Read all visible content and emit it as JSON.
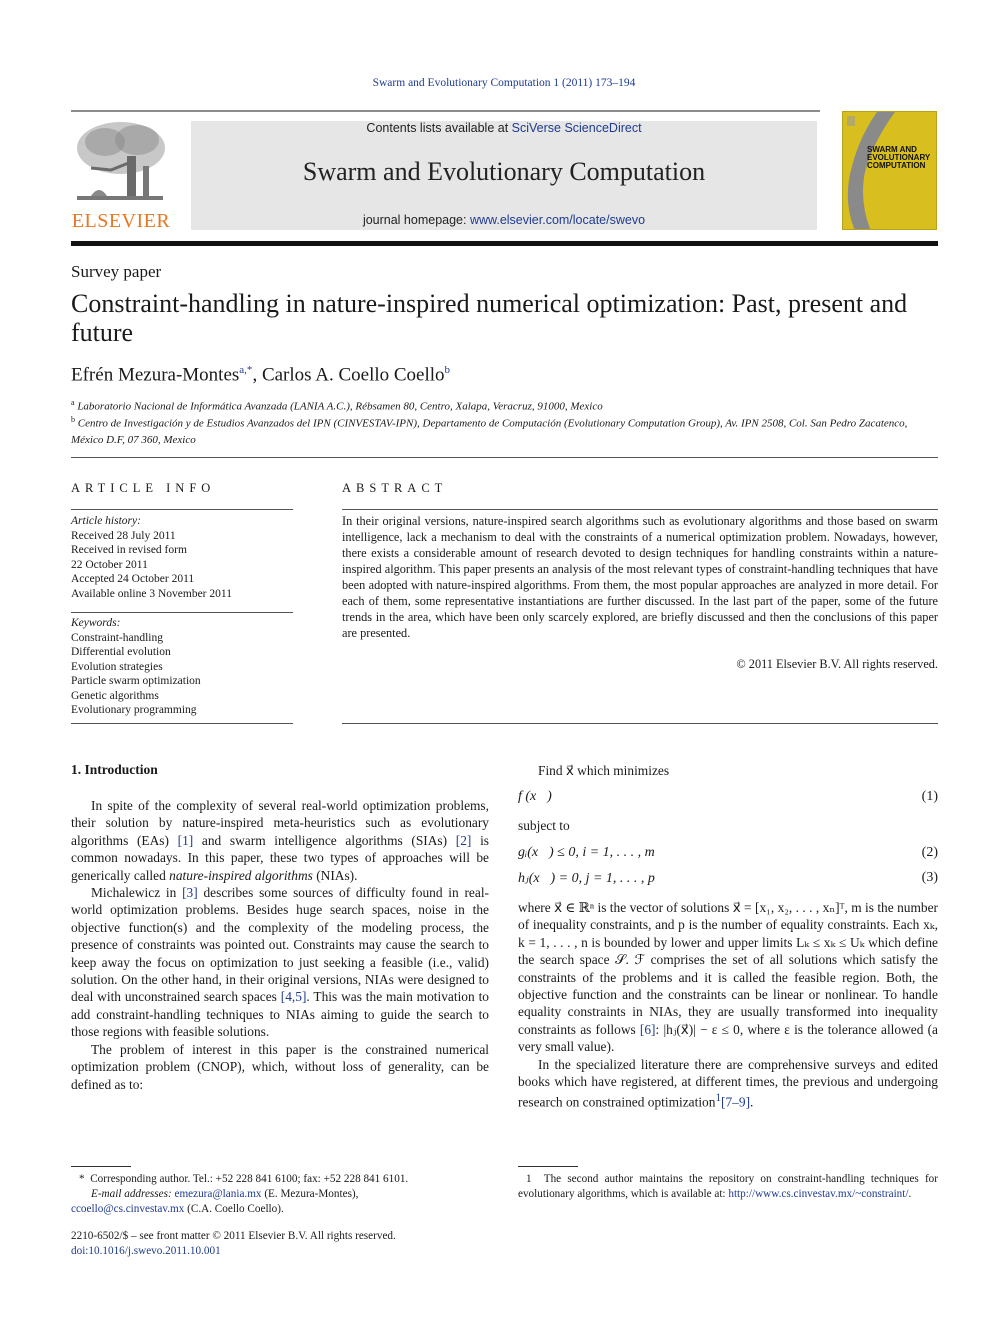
{
  "running_head": "Swarm and Evolutionary Computation 1 (2011) 173–194",
  "masthead": {
    "publisher_logo_text": "ELSEVIER",
    "contents_prefix": "Contents lists available at ",
    "contents_link": "SciVerse ScienceDirect",
    "journal_title": "Swarm and Evolutionary Computation",
    "homepage_prefix": "journal homepage: ",
    "homepage_link": "www.elsevier.com/locate/swevo",
    "cover_title_lines": [
      "SWARM AND",
      "EVOLUTIONARY",
      "COMPUTATION"
    ],
    "colors": {
      "link": "#1f3a8f",
      "elsevier_orange": "#e87722",
      "cover_yellow": "#d8bf1f",
      "cover_gray": "#8a8a8a",
      "box_gray": "#e6e6e6"
    }
  },
  "article": {
    "type": "Survey paper",
    "title": "Constraint-handling in nature-inspired numerical optimization: Past, present and future",
    "authors": [
      {
        "name": "Efrén Mezura-Montes",
        "marks": "a,*"
      },
      {
        "name": "Carlos A. Coello Coello",
        "marks": "b"
      }
    ],
    "author_separator": ", ",
    "affiliations": [
      {
        "mark": "a",
        "text": "Laboratorio Nacional de Informática Avanzada (LANIA A.C.), Rébsamen 80, Centro, Xalapa, Veracruz, 91000, Mexico"
      },
      {
        "mark": "b",
        "text": "Centro de Investigación y de Estudios Avanzados del IPN (CINVESTAV-IPN), Departamento de Computación (Evolutionary Computation Group), Av. IPN 2508, Col. San Pedro Zacatenco, México D.F, 07 360, Mexico"
      }
    ]
  },
  "article_info": {
    "heading": "ARTICLE INFO",
    "history_label": "Article history:",
    "history": [
      "Received 28 July 2011",
      "Received in revised form",
      "22 October 2011",
      "Accepted 24 October 2011",
      "Available online 3 November 2011"
    ],
    "keywords_label": "Keywords:",
    "keywords": [
      "Constraint-handling",
      "Differential evolution",
      "Evolution strategies",
      "Particle swarm optimization",
      "Genetic algorithms",
      "Evolutionary programming"
    ]
  },
  "abstract": {
    "heading": "ABSTRACT",
    "text": "In their original versions, nature-inspired search algorithms such as evolutionary algorithms and those based on swarm intelligence, lack a mechanism to deal with the constraints of a numerical optimization problem. Nowadays, however, there exists a considerable amount of research devoted to design techniques for handling constraints within a nature-inspired algorithm. This paper presents an analysis of the most relevant types of constraint-handling techniques that have been adopted with nature-inspired algorithms. From them, the most popular approaches are analyzed in more detail. For each of them, some representative instantiations are further discussed. In the last part of the paper, some of the future trends in the area, which have been only scarcely explored, are briefly discussed and then the conclusions of this paper are presented.",
    "copyright": "© 2011 Elsevier B.V. All rights reserved."
  },
  "introduction": {
    "heading": "1.  Introduction",
    "p1": {
      "a": "In spite of the complexity of several real-world optimization problems, their solution by nature-inspired meta-heuristics such as evolutionary algorithms (EAs) ",
      "ref1": "[1]",
      "b": " and swarm intelligence algorithms (SIAs) ",
      "ref2": "[2]",
      "c": " is common nowadays. In this paper, these two types of approaches will be generically called ",
      "em": "nature-inspired algorithms",
      "d": " (NIAs)."
    },
    "p2": {
      "a": "Michalewicz in ",
      "ref": "[3]",
      "b": " describes some sources of difficulty found in real-world optimization problems. Besides huge search spaces, noise in the objective function(s) and the complexity of the modeling process, the presence of constraints was pointed out. Constraints may cause the search to keep away the focus on optimization to just seeking a feasible (i.e., valid) solution. On the other hand, in their original versions, NIAs were designed to deal with unconstrained search spaces ",
      "ref2": "[4,5]",
      "c": ". This was the main motivation to add constraint-handling techniques to NIAs aiming to guide the search to those regions with feasible solutions."
    },
    "p3": "The problem of interest in this paper is the constrained numerical optimization problem (CNOP), which, without loss of generality, can be defined as to:"
  },
  "problem": {
    "find_line": "Find x⃗ which minimizes",
    "eq1": "f (x⃗)",
    "eq1_num": "(1)",
    "subject_to": "subject to",
    "eq2": "gᵢ(x⃗) ≤ 0,    i = 1, . . . , m",
    "eq2_num": "(2)",
    "eq3": "hⱼ(x⃗) = 0,    j = 1, . . . , p",
    "eq3_num": "(3)",
    "p_where": "where x⃗ ∈ ℝⁿ is the vector of solutions x⃗ = [x₁, x₂, . . . , xₙ]ᵀ, m is the number of inequality constraints, and p is the number of equality constraints. Each xₖ,  k  = 1, . . . , n is bounded by lower and upper limits Lₖ ≤ xₖ ≤ Uₖ which define the search space 𝒮. ℱ comprises the set of all solutions which satisfy the constraints of the problems and it is called the feasible region. Both, the objective function and the constraints can be linear or nonlinear. To handle equality constraints in NIAs, they are usually transformed into inequality constraints as follows ",
    "p_where_ref": "[6]",
    "p_where_end": ": |hⱼ(x⃗)| − ε ≤ 0, where ε is the tolerance allowed (a very small value).",
    "p_lit": "In the specialized literature there are comprehensive surveys and edited books which have registered, at different times, the previous and undergoing research on constrained optimization",
    "p_lit_fn": "1",
    "p_lit_ref": "[7–9]",
    "p_lit_end": "."
  },
  "footnotes": {
    "corresponding_mark": "*",
    "corresponding": "Corresponding author. Tel.: +52 228 841 6100; fax: +52 228 841 6101.",
    "email_label": "E-mail addresses:",
    "email1": "emezura@lania.mx",
    "email1_owner": " (E. Mezura-Montes),",
    "email2": "ccoello@cs.cinvestav.mx",
    "email2_owner": " (C.A. Coello Coello).",
    "fn1_mark": "1",
    "fn1_text": "The second author maintains the repository on constraint-handling techniques for evolutionary algorithms, which is available at: ",
    "fn1_link": "http://www.cs.cinvestav.mx/~constraint/",
    "fn1_end": ".",
    "issn": "2210-6502/$ – see front matter © 2011 Elsevier B.V. All rights reserved.",
    "doi": "doi:10.1016/j.swevo.2011.10.001"
  }
}
